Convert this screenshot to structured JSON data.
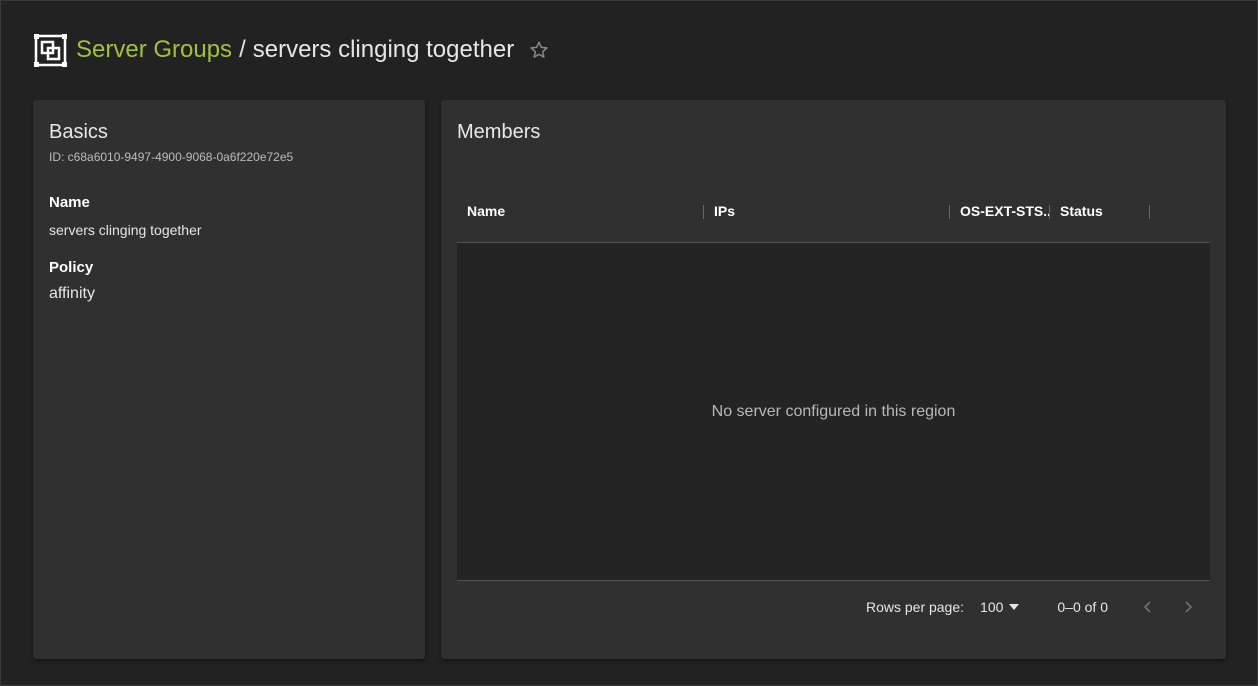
{
  "header": {
    "app_icon": "server-group-icon",
    "breadcrumb_link": "Server Groups",
    "separator": "/",
    "current": "servers clinging together",
    "favorite_icon": "star-outline-icon"
  },
  "basics": {
    "title": "Basics",
    "id_text": "ID: c68a6010-9497-4900-9068-0a6f220e72e5",
    "name_label": "Name",
    "name_value": "servers clinging together",
    "policy_label": "Policy",
    "policy_value": "affinity"
  },
  "members": {
    "title": "Members",
    "columns": [
      "Name",
      "IPs",
      "OS-EXT-STS...",
      "Status"
    ],
    "empty_message": "No server configured in this region",
    "pagination": {
      "rows_per_page_label": "Rows per page:",
      "rows_per_page_value": "100",
      "range_text": "0–0 of 0"
    }
  },
  "colors": {
    "background": "#222222",
    "card": "#303030",
    "accent": "#a2c13a"
  }
}
